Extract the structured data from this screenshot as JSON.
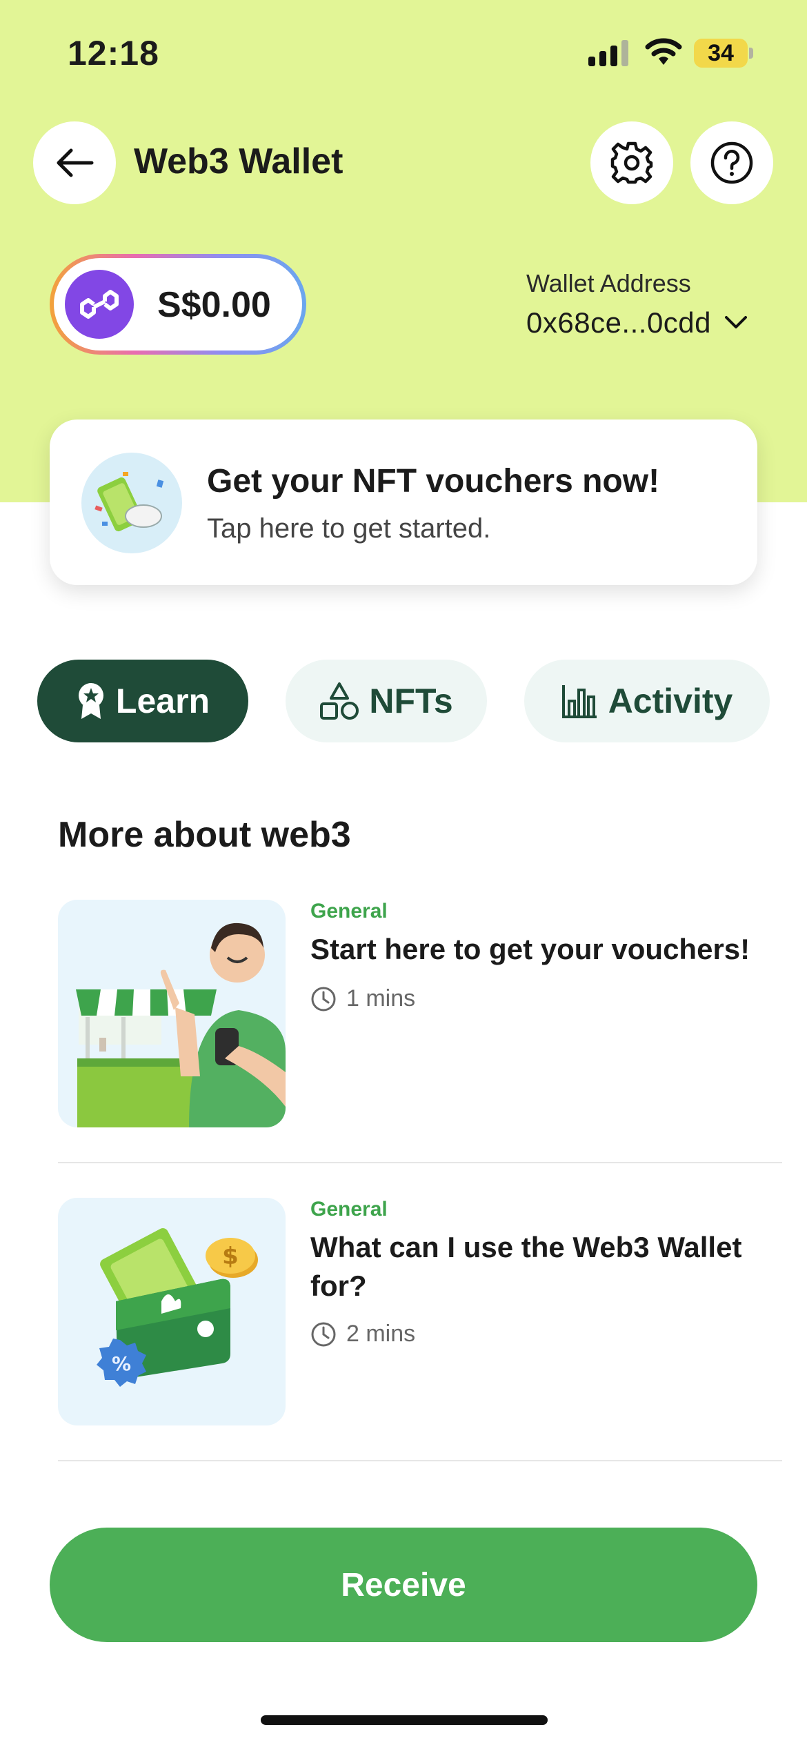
{
  "status_bar": {
    "time": "12:18",
    "battery": "34"
  },
  "header": {
    "title": "Web3 Wallet"
  },
  "balance": {
    "amount": "S$0.00"
  },
  "wallet": {
    "label": "Wallet Address",
    "address": "0x68ce...0cdd"
  },
  "promo": {
    "title": "Get your NFT vouchers now!",
    "subtitle": "Tap here to get started."
  },
  "tabs": [
    {
      "label": "Learn",
      "icon": "award-icon",
      "active": true
    },
    {
      "label": "NFTs",
      "icon": "shapes-icon",
      "active": false
    },
    {
      "label": "Activity",
      "icon": "bar-chart-icon",
      "active": false
    }
  ],
  "section": {
    "title": "More about web3"
  },
  "articles": [
    {
      "category": "General",
      "title": "Start here to get your vouchers!",
      "duration": "1 mins"
    },
    {
      "category": "General",
      "title": "What can I use the Web3 Wallet for?",
      "duration": "2 mins"
    }
  ],
  "footer": {
    "receive_label": "Receive"
  },
  "colors": {
    "header_bg": "#e2f596",
    "primary_green": "#4caf57",
    "dark_green": "#1f4b38",
    "polygon_purple": "#8247e5"
  }
}
